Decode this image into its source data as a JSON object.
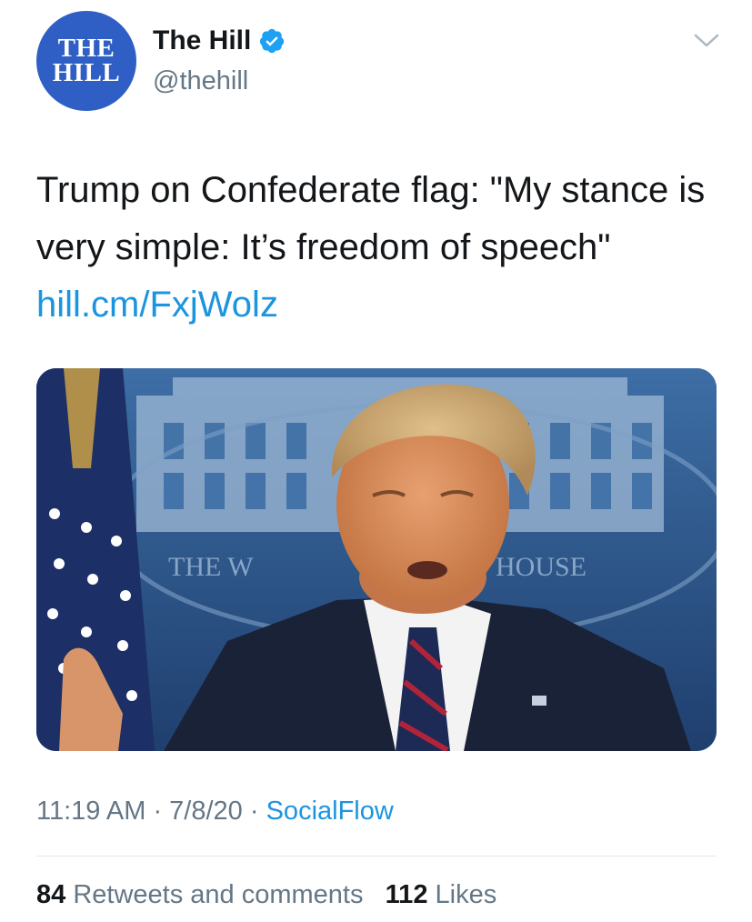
{
  "author": {
    "avatar_text_line1": "THE",
    "avatar_text_line2": "HILL",
    "display_name": "The Hill",
    "handle": "@thehill",
    "verified": true,
    "avatar_color": "#2f5fc4"
  },
  "tweet": {
    "text": "Trump on Confederate flag: \"My stance is very simple: It’s freedom of speech\" ",
    "link_text": "hill.cm/FxjWolz",
    "media_sign_text_left": "THE W",
    "media_sign_text_right": "HOUSE"
  },
  "meta": {
    "time": "11:19 AM",
    "separator1": " · ",
    "date": "7/8/20",
    "separator2": " · ",
    "source": "SocialFlow"
  },
  "stats": {
    "retweets_count": "84",
    "retweets_label": "Retweets and comments",
    "likes_count": "112",
    "likes_label": "Likes"
  },
  "colors": {
    "link": "#1b95e0",
    "secondary_text": "#657786",
    "primary_text": "#14171a",
    "verified_badge": "#1da1f2"
  },
  "icons": [
    "verified-badge-icon",
    "chevron-down-icon"
  ]
}
